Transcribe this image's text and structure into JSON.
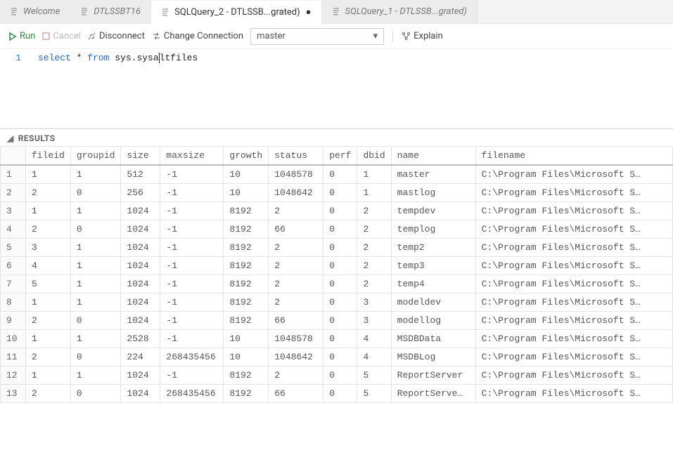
{
  "tabs": [
    {
      "label": "Welcome",
      "active": false,
      "dirty": false,
      "italic": true
    },
    {
      "label": "DTLSSBT16",
      "active": false,
      "dirty": false,
      "italic": true
    },
    {
      "label": "SQLQuery_2 - DTLSSB...grated)",
      "active": true,
      "dirty": true,
      "italic": false
    },
    {
      "label": "SQLQuery_1 - DTLSSB...grated)",
      "active": false,
      "dirty": false,
      "italic": true
    }
  ],
  "toolbar": {
    "run_label": "Run",
    "cancel_label": "Cancel",
    "disconnect_label": "Disconnect",
    "change_conn_label": "Change Connection",
    "db_selected": "master",
    "explain_label": "Explain"
  },
  "editor": {
    "line_num": "1",
    "tokens": {
      "k1": "select",
      "op": " * ",
      "k2": "from",
      "sp": " ",
      "tbl_pre": "sys.sysa",
      "tbl_post": "ltfiles"
    }
  },
  "results": {
    "panel_title": "RESULTS",
    "columns": [
      "fileid",
      "groupid",
      "size",
      "maxsize",
      "growth",
      "status",
      "perf",
      "dbid",
      "name",
      "filename"
    ],
    "rows": [
      [
        "1",
        "1",
        "512",
        "-1",
        "10",
        "1048578",
        "0",
        "1",
        "master",
        "C:\\Program Files\\Microsoft S…"
      ],
      [
        "2",
        "0",
        "256",
        "-1",
        "10",
        "1048642",
        "0",
        "1",
        "mastlog",
        "C:\\Program Files\\Microsoft S…"
      ],
      [
        "1",
        "1",
        "1024",
        "-1",
        "8192",
        "2",
        "0",
        "2",
        "tempdev",
        "C:\\Program Files\\Microsoft S…"
      ],
      [
        "2",
        "0",
        "1024",
        "-1",
        "8192",
        "66",
        "0",
        "2",
        "templog",
        "C:\\Program Files\\Microsoft S…"
      ],
      [
        "3",
        "1",
        "1024",
        "-1",
        "8192",
        "2",
        "0",
        "2",
        "temp2",
        "C:\\Program Files\\Microsoft S…"
      ],
      [
        "4",
        "1",
        "1024",
        "-1",
        "8192",
        "2",
        "0",
        "2",
        "temp3",
        "C:\\Program Files\\Microsoft S…"
      ],
      [
        "5",
        "1",
        "1024",
        "-1",
        "8192",
        "2",
        "0",
        "2",
        "temp4",
        "C:\\Program Files\\Microsoft S…"
      ],
      [
        "1",
        "1",
        "1024",
        "-1",
        "8192",
        "2",
        "0",
        "3",
        "modeldev",
        "C:\\Program Files\\Microsoft S…"
      ],
      [
        "2",
        "0",
        "1024",
        "-1",
        "8192",
        "66",
        "0",
        "3",
        "modellog",
        "C:\\Program Files\\Microsoft S…"
      ],
      [
        "1",
        "1",
        "2528",
        "-1",
        "10",
        "1048578",
        "0",
        "4",
        "MSDBData",
        "C:\\Program Files\\Microsoft S…"
      ],
      [
        "2",
        "0",
        "224",
        "268435456",
        "10",
        "1048642",
        "0",
        "4",
        "MSDBLog",
        "C:\\Program Files\\Microsoft S…"
      ],
      [
        "1",
        "1",
        "1024",
        "-1",
        "8192",
        "2",
        "0",
        "5",
        "ReportServer",
        "C:\\Program Files\\Microsoft S…"
      ],
      [
        "2",
        "0",
        "1024",
        "268435456",
        "8192",
        "66",
        "0",
        "5",
        "ReportServe…",
        "C:\\Program Files\\Microsoft S…"
      ]
    ]
  }
}
